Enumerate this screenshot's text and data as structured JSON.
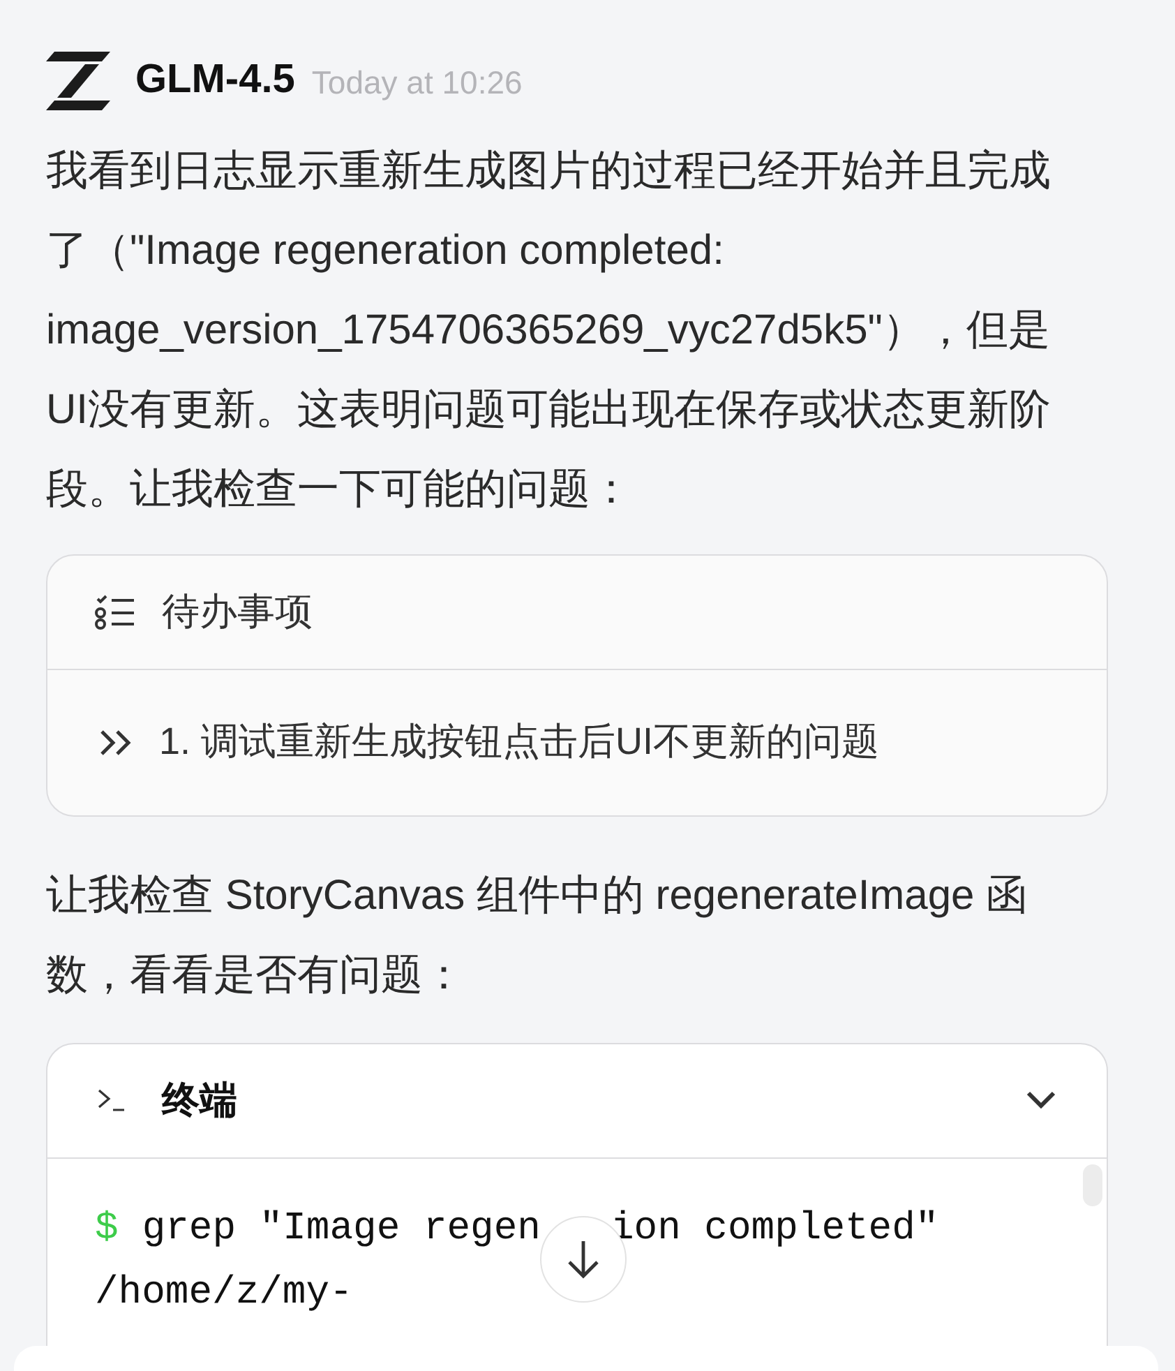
{
  "header": {
    "model": "GLM-4.5",
    "time": "Today at 10:26"
  },
  "intro": "我看到日志显示重新生成图片的过程已经开始并且完成了（\"Image regeneration completed: image_version_1754706365269_vyc27d5k5\"），但是UI没有更新。这表明问题可能出现在保存或状态更新阶段。让我检查一下可能的问题：",
  "todo": {
    "title": "待办事项",
    "items": [
      {
        "text": "1. 调试重新生成按钮点击后UI不更新的问题"
      }
    ]
  },
  "middle": "让我检查 StoryCanvas 组件中的 regenerateImage 函数，看看是否有问题：",
  "terminal": {
    "title": "终端",
    "expanded": true,
    "lines": [
      {
        "prompt": "$",
        "parts": [
          "grep \"Image regen",
          "ion completed\""
        ]
      },
      {
        "parts": [
          "/home/z/my-"
        ]
      }
    ]
  }
}
